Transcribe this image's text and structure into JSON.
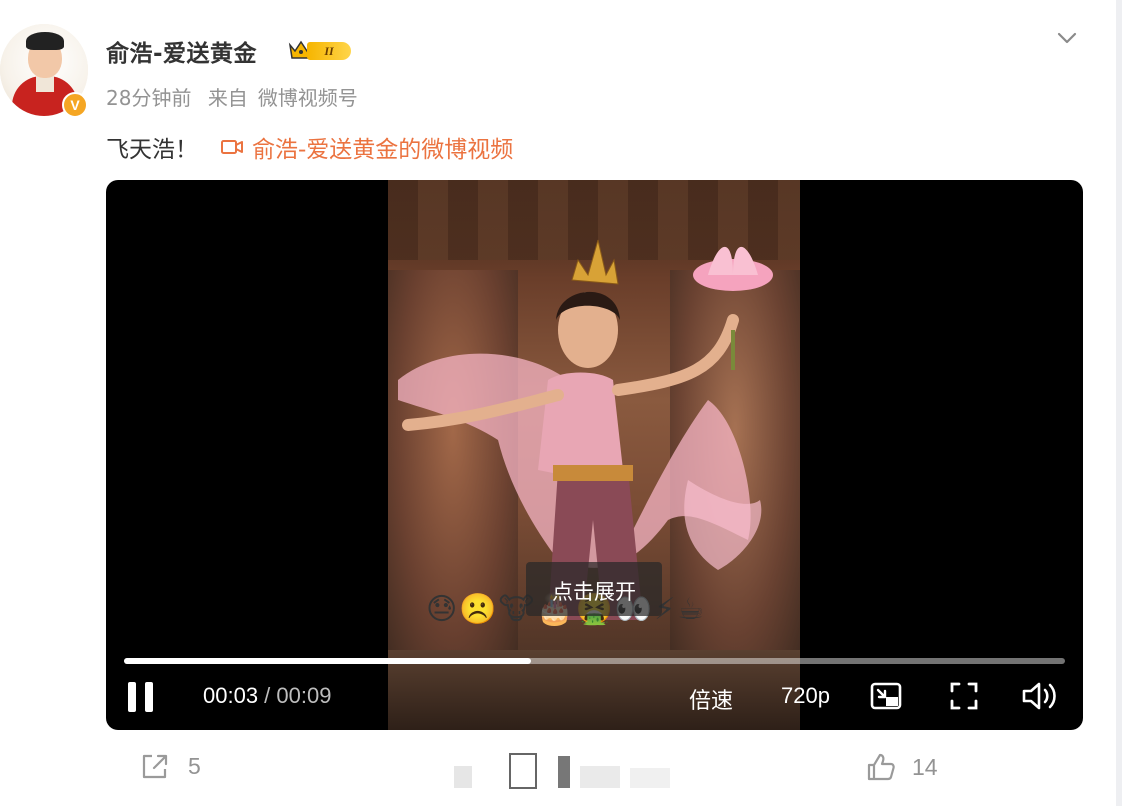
{
  "post": {
    "username": "俞浩-爱送黄金",
    "level_badge": "II",
    "time": "28分钟前",
    "source_prefix": "来自",
    "source": "微博视频号",
    "text": "飞天浩！",
    "video_link": "俞浩-爱送黄金的微博视频"
  },
  "video": {
    "expand_tip": "点击展开",
    "danmaku": "😓☹️🐮🎂🤮👀⚡☕",
    "current_time": "00:03",
    "separator": " / ",
    "duration": "00:09",
    "progress": 0.433,
    "speed_label": "倍速",
    "quality_label": "720p"
  },
  "footer": {
    "share_count": "5",
    "like_count": "14"
  },
  "colors": {
    "link": "#eb7340",
    "meta": "#939393",
    "badge": "#f5a623"
  }
}
